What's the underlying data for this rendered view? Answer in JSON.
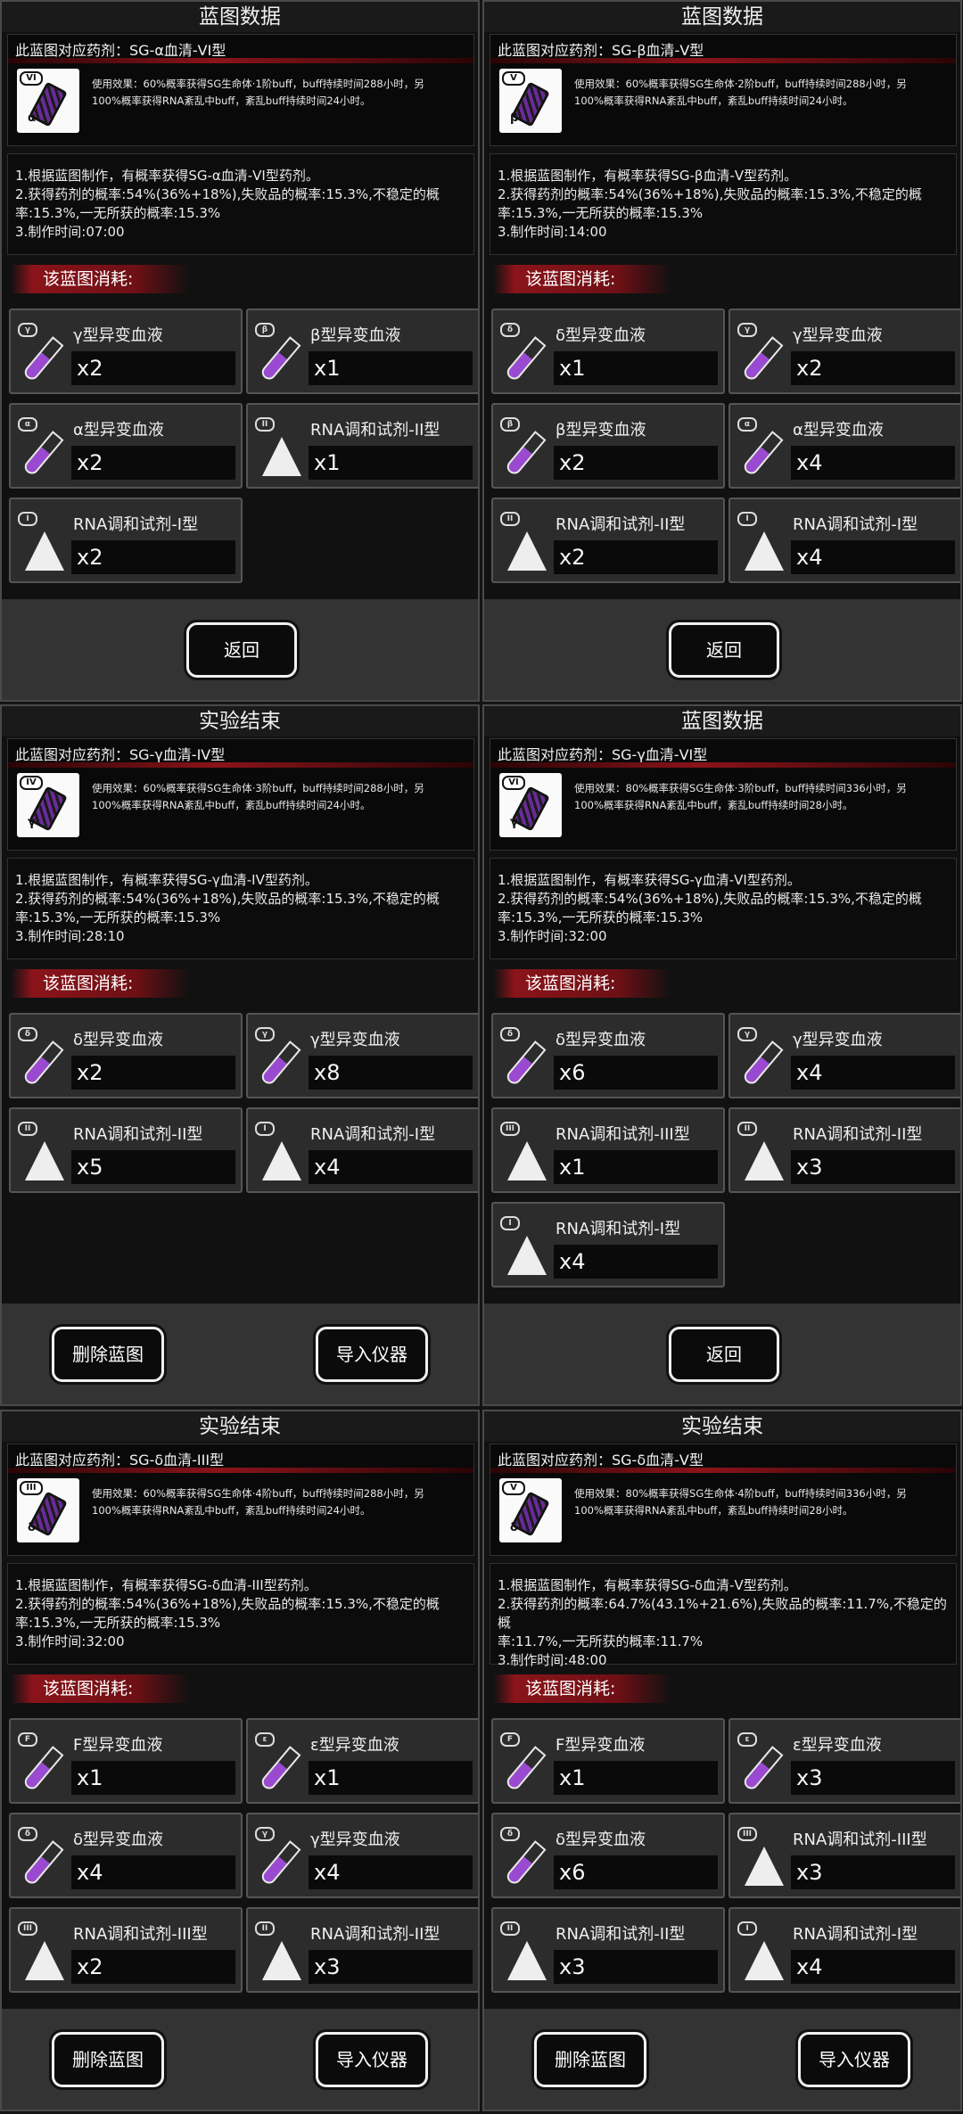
{
  "panels": [
    {
      "title": "蓝图数据",
      "drug": "此蓝图对应药剂：SG-α血清-VI型",
      "roman": "VI",
      "greek": "α",
      "effect": [
        "使用效果：60%概率获得SG生命体·1阶buff，buff持续时间288小时，另",
        "100%概率获得RNA紊乱中buff，紊乱buff持续时间24小时。"
      ],
      "desc": [
        "1.根据蓝图制作，有概率获得SG-α血清-VI型药剂。",
        "2.获得药剂的概率:54%(36%+18%),失败品的概率:15.3%,不稳定的概",
        "率:15.3%,一无所获的概率:15.3%",
        "3.制作时间:07:00"
      ],
      "consume_label": "该蓝图消耗:",
      "items": [
        {
          "kind": "tube",
          "tag": "γ",
          "name": "γ型异变血液",
          "qty": "x2"
        },
        {
          "kind": "tube",
          "tag": "β",
          "name": "β型异变血液",
          "qty": "x1"
        },
        {
          "kind": "tube",
          "tag": "α",
          "name": "α型异变血液",
          "qty": "x2"
        },
        {
          "kind": "flask",
          "tag": "II",
          "name": "RNA调和试剂-II型",
          "qty": "x1"
        },
        {
          "kind": "flask",
          "tag": "I",
          "name": "RNA调和试剂-I型",
          "qty": "x2"
        }
      ],
      "buttons": [
        "返回"
      ]
    },
    {
      "title": "蓝图数据",
      "drug": "此蓝图对应药剂：SG-β血清-V型",
      "roman": "V",
      "greek": "β",
      "effect": [
        "使用效果：60%概率获得SG生命体·2阶buff，buff持续时间288小时，另",
        "100%概率获得RNA紊乱中buff，紊乱buff持续时间24小时。"
      ],
      "desc": [
        "1.根据蓝图制作，有概率获得SG-β血清-V型药剂。",
        "2.获得药剂的概率:54%(36%+18%),失败品的概率:15.3%,不稳定的概",
        "率:15.3%,一无所获的概率:15.3%",
        "3.制作时间:14:00"
      ],
      "consume_label": "该蓝图消耗:",
      "items": [
        {
          "kind": "tube",
          "tag": "δ",
          "name": "δ型异变血液",
          "qty": "x1"
        },
        {
          "kind": "tube",
          "tag": "γ",
          "name": "γ型异变血液",
          "qty": "x2"
        },
        {
          "kind": "tube",
          "tag": "β",
          "name": "β型异变血液",
          "qty": "x2"
        },
        {
          "kind": "tube",
          "tag": "α",
          "name": "α型异变血液",
          "qty": "x4"
        },
        {
          "kind": "flask",
          "tag": "II",
          "name": "RNA调和试剂-II型",
          "qty": "x2"
        },
        {
          "kind": "flask",
          "tag": "I",
          "name": "RNA调和试剂-I型",
          "qty": "x4"
        }
      ],
      "buttons": [
        "返回"
      ]
    },
    {
      "title": "实验结束",
      "drug": "此蓝图对应药剂：SG-γ血清-IV型",
      "roman": "IV",
      "greek": "γ",
      "effect": [
        "使用效果：60%概率获得SG生命体·3阶buff，buff持续时间288小时，另",
        "100%概率获得RNA紊乱中buff，紊乱buff持续时间24小时。"
      ],
      "desc": [
        "1.根据蓝图制作，有概率获得SG-γ血清-IV型药剂。",
        "2.获得药剂的概率:54%(36%+18%),失败品的概率:15.3%,不稳定的概",
        "率:15.3%,一无所获的概率:15.3%",
        "3.制作时间:28:10"
      ],
      "consume_label": "该蓝图消耗:",
      "items": [
        {
          "kind": "tube",
          "tag": "δ",
          "name": "δ型异变血液",
          "qty": "x2"
        },
        {
          "kind": "tube",
          "tag": "γ",
          "name": "γ型异变血液",
          "qty": "x8"
        },
        {
          "kind": "flask",
          "tag": "II",
          "name": "RNA调和试剂-II型",
          "qty": "x5"
        },
        {
          "kind": "flask",
          "tag": "I",
          "name": "RNA调和试剂-I型",
          "qty": "x4"
        }
      ],
      "buttons": [
        "删除蓝图",
        "导入仪器"
      ]
    },
    {
      "title": "蓝图数据",
      "drug": "此蓝图对应药剂：SG-γ血清-VI型",
      "roman": "VI",
      "greek": "γ",
      "effect": [
        "使用效果：80%概率获得SG生命体·3阶buff，buff持续时间336小时，另",
        "100%概率获得RNA紊乱中buff，紊乱buff持续时间28小时。"
      ],
      "desc": [
        "1.根据蓝图制作，有概率获得SG-γ血清-VI型药剂。",
        "2.获得药剂的概率:54%(36%+18%),失败品的概率:15.3%,不稳定的概",
        "率:15.3%,一无所获的概率:15.3%",
        "3.制作时间:32:00"
      ],
      "consume_label": "该蓝图消耗:",
      "items": [
        {
          "kind": "tube",
          "tag": "δ",
          "name": "δ型异变血液",
          "qty": "x6"
        },
        {
          "kind": "tube",
          "tag": "γ",
          "name": "γ型异变血液",
          "qty": "x4"
        },
        {
          "kind": "flask",
          "tag": "III",
          "name": "RNA调和试剂-III型",
          "qty": "x1"
        },
        {
          "kind": "flask",
          "tag": "II",
          "name": "RNA调和试剂-II型",
          "qty": "x3"
        },
        {
          "kind": "flask",
          "tag": "I",
          "name": "RNA调和试剂-I型",
          "qty": "x4"
        }
      ],
      "buttons": [
        "返回"
      ]
    },
    {
      "title": "实验结束",
      "drug": "此蓝图对应药剂：SG-δ血清-III型",
      "roman": "III",
      "greek": "δ",
      "effect": [
        "使用效果：60%概率获得SG生命体·4阶buff，buff持续时间288小时，另",
        "100%概率获得RNA紊乱中buff，紊乱buff持续时间24小时。"
      ],
      "desc": [
        "1.根据蓝图制作，有概率获得SG-δ血清-III型药剂。",
        "2.获得药剂的概率:54%(36%+18%),失败品的概率:15.3%,不稳定的概",
        "率:15.3%,一无所获的概率:15.3%",
        "3.制作时间:32:00"
      ],
      "consume_label": "该蓝图消耗:",
      "items": [
        {
          "kind": "tube",
          "tag": "F",
          "name": "F型异变血液",
          "qty": "x1"
        },
        {
          "kind": "tube",
          "tag": "ε",
          "name": "ε型异变血液",
          "qty": "x1"
        },
        {
          "kind": "tube",
          "tag": "δ",
          "name": "δ型异变血液",
          "qty": "x4"
        },
        {
          "kind": "tube",
          "tag": "γ",
          "name": "γ型异变血液",
          "qty": "x4"
        },
        {
          "kind": "flask",
          "tag": "III",
          "name": "RNA调和试剂-III型",
          "qty": "x2"
        },
        {
          "kind": "flask",
          "tag": "II",
          "name": "RNA调和试剂-II型",
          "qty": "x3"
        }
      ],
      "buttons": [
        "删除蓝图",
        "导入仪器"
      ]
    },
    {
      "title": "实验结束",
      "drug": "此蓝图对应药剂：SG-δ血清-V型",
      "roman": "V",
      "greek": "δ",
      "effect": [
        "使用效果：80%概率获得SG生命体·4阶buff，buff持续时间336小时，另",
        "100%概率获得RNA紊乱中buff，紊乱buff持续时间28小时。"
      ],
      "desc": [
        "1.根据蓝图制作，有概率获得SG-δ血清-V型药剂。",
        "2.获得药剂的概率:64.7%(43.1%+21.6%),失败品的概率:11.7%,不稳定的概",
        "率:11.7%,一无所获的概率:11.7%",
        "3.制作时间:48:00"
      ],
      "consume_label": "该蓝图消耗:",
      "items": [
        {
          "kind": "tube",
          "tag": "F",
          "name": "F型异变血液",
          "qty": "x1"
        },
        {
          "kind": "tube",
          "tag": "ε",
          "name": "ε型异变血液",
          "qty": "x3"
        },
        {
          "kind": "tube",
          "tag": "δ",
          "name": "δ型异变血液",
          "qty": "x6"
        },
        {
          "kind": "flask",
          "tag": "III",
          "name": "RNA调和试剂-III型",
          "qty": "x3"
        },
        {
          "kind": "flask",
          "tag": "II",
          "name": "RNA调和试剂-II型",
          "qty": "x3"
        },
        {
          "kind": "flask",
          "tag": "I",
          "name": "RNA调和试剂-I型",
          "qty": "x4"
        }
      ],
      "buttons": [
        "删除蓝图",
        "导入仪器"
      ]
    }
  ]
}
